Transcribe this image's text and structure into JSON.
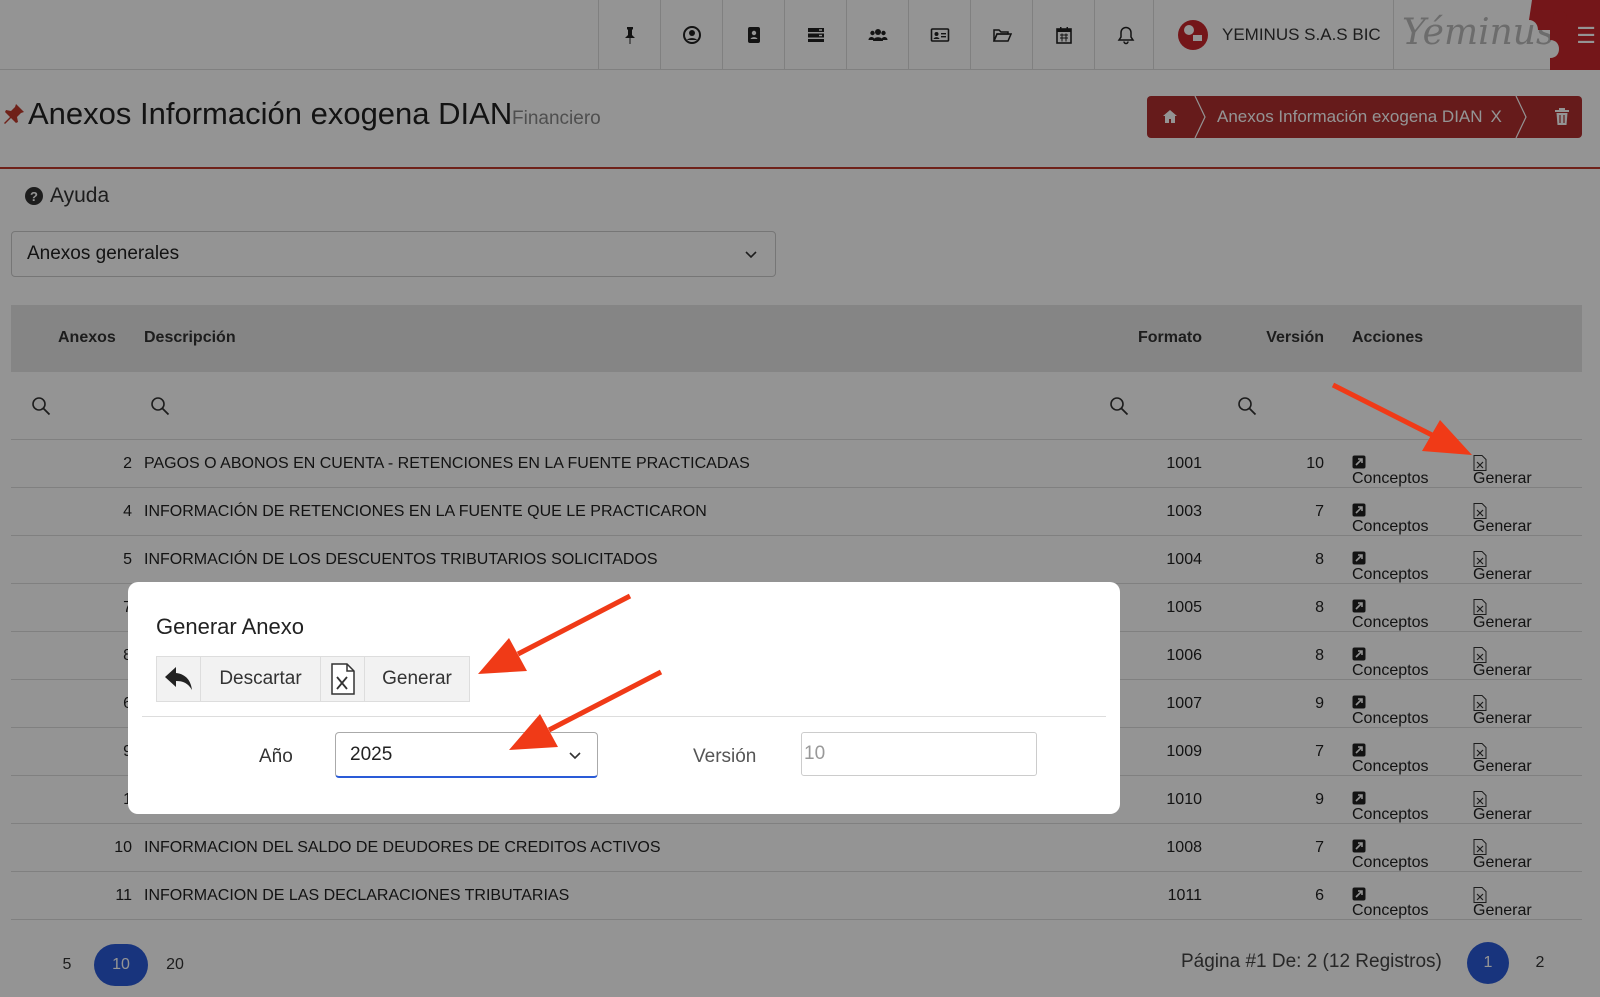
{
  "company": {
    "name": "YEMINUS S.A.S BIC",
    "brand": "Yéminus"
  },
  "header": {
    "title": "Anexos Información exogena DIAN",
    "subtitle": "Financiero"
  },
  "breadcrumb": {
    "label": "Anexos Información exogena DIAN",
    "close": "X"
  },
  "help": {
    "label": "Ayuda"
  },
  "filter_select": {
    "value": "Anexos generales"
  },
  "table": {
    "columns": {
      "anexos": "Anexos",
      "descripcion": "Descripción",
      "formato": "Formato",
      "version": "Versión",
      "acciones": "Acciones"
    },
    "action_labels": {
      "conceptos": "Conceptos",
      "generar": "Generar"
    },
    "rows": [
      {
        "anexo": "2",
        "descripcion": "PAGOS O ABONOS EN CUENTA - RETENCIONES EN LA FUENTE PRACTICADAS",
        "formato": "1001",
        "version": "10"
      },
      {
        "anexo": "4",
        "descripcion": "INFORMACIÓN DE RETENCIONES EN LA FUENTE QUE LE PRACTICARON",
        "formato": "1003",
        "version": "7"
      },
      {
        "anexo": "5",
        "descripcion": "INFORMACIÓN DE LOS DESCUENTOS TRIBUTARIOS SOLICITADOS",
        "formato": "1004",
        "version": "8"
      },
      {
        "anexo": "7",
        "descripcion": "",
        "formato": "1005",
        "version": "8"
      },
      {
        "anexo": "8",
        "descripcion": "",
        "formato": "1006",
        "version": "8"
      },
      {
        "anexo": "6",
        "descripcion": "",
        "formato": "1007",
        "version": "9"
      },
      {
        "anexo": "9",
        "descripcion": "",
        "formato": "1009",
        "version": "7"
      },
      {
        "anexo": "1",
        "descripcion": "",
        "formato": "1010",
        "version": "9"
      },
      {
        "anexo": "10",
        "descripcion": "INFORMACION DEL SALDO DE DEUDORES DE CREDITOS ACTIVOS",
        "formato": "1008",
        "version": "7"
      },
      {
        "anexo": "11",
        "descripcion": "INFORMACION DE LAS DECLARACIONES TRIBUTARIAS",
        "formato": "1011",
        "version": "6"
      }
    ]
  },
  "pagination": {
    "page_sizes": [
      "5",
      "10",
      "20"
    ],
    "active_size": "10",
    "info": "Página #1 De: 2 (12 Registros)",
    "pages": [
      "1",
      "2"
    ],
    "active_page": "1"
  },
  "modal": {
    "title": "Generar Anexo",
    "discard_label": "Descartar",
    "generate_label": "Generar",
    "year_label": "Año",
    "year_value": "2025",
    "version_label": "Versión",
    "version_value": "10"
  },
  "colors": {
    "accent": "#b03030",
    "primary": "#2a5bd7",
    "arrow": "#f03a17"
  }
}
